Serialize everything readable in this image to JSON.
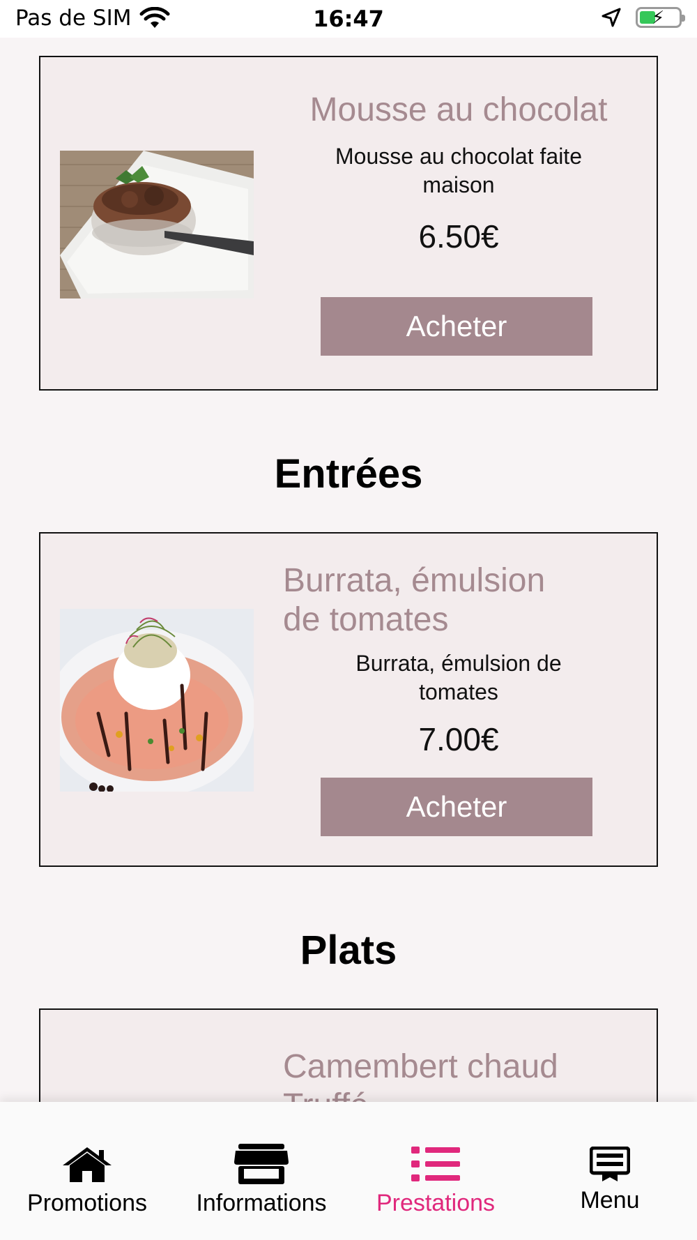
{
  "status_bar": {
    "carrier": "Pas de SIM",
    "time": "16:47"
  },
  "cards": [
    {
      "title": "Mousse au chocolat",
      "description": "Mousse au chocolat faite maison",
      "price": "6.50€",
      "button": "Acheter"
    },
    {
      "title": "Burrata, émulsion de tomates",
      "description": "Burrata, émulsion de tomates",
      "price": "7.00€",
      "button": "Acheter"
    },
    {
      "title": "Camembert chaud Truffé"
    }
  ],
  "sections": {
    "entrees": "Entrées",
    "plats": "Plats"
  },
  "tabbar": {
    "promotions": "Promotions",
    "informations": "Informations",
    "prestations": "Prestations",
    "menu": "Menu",
    "active_color": "#e0287c"
  },
  "colors": {
    "accent_button": "#a4888e",
    "title_color": "#a58a90",
    "card_bg": "#f3eced"
  }
}
